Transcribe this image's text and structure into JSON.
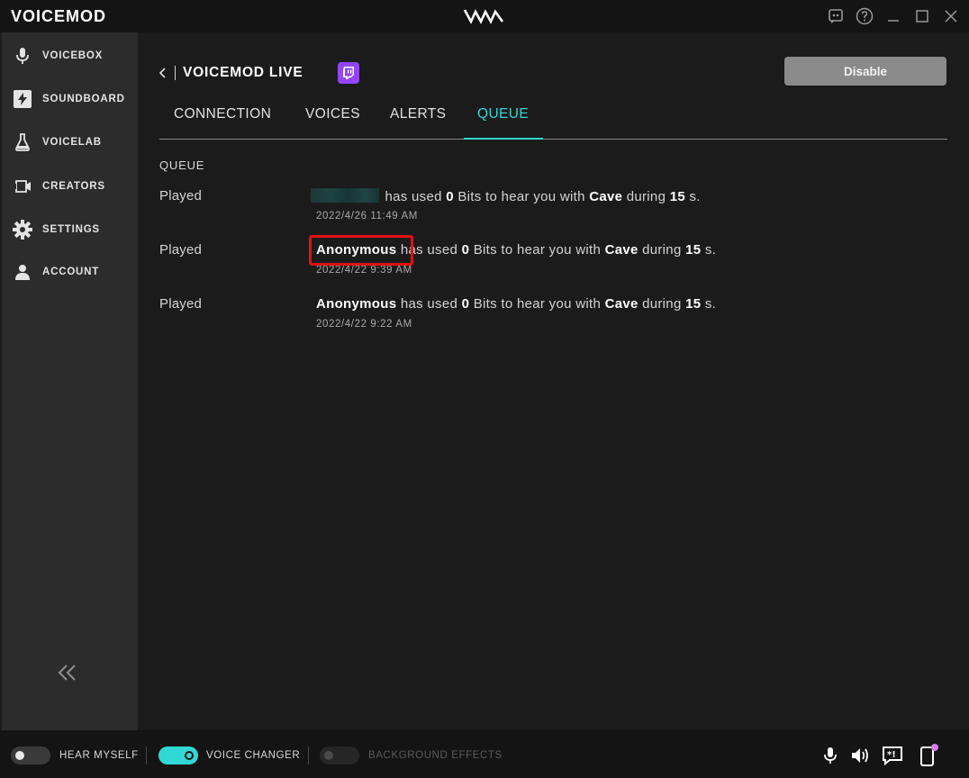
{
  "app": {
    "brand": "VOICEMOD",
    "logo_icon": "vm-logo-icon"
  },
  "window_controls": [
    {
      "name": "discord-icon"
    },
    {
      "name": "help-icon"
    },
    {
      "name": "minimize-icon"
    },
    {
      "name": "maximize-icon"
    },
    {
      "name": "close-icon"
    }
  ],
  "sidebar": {
    "items": [
      {
        "label": "VOICEBOX",
        "icon": "microphone-icon"
      },
      {
        "label": "SOUNDBOARD",
        "icon": "lightning-icon"
      },
      {
        "label": "VOICELAB",
        "icon": "flask-icon"
      },
      {
        "label": "CREATORS",
        "icon": "camera-icon"
      },
      {
        "label": "SETTINGS",
        "icon": "gear-icon"
      },
      {
        "label": "ACCOUNT",
        "icon": "user-icon"
      }
    ],
    "collapse_icon": "double-chevron-left-icon"
  },
  "header": {
    "title": "VOICEMOD LIVE",
    "disable_label": "Disable"
  },
  "tabs": [
    {
      "label": "CONNECTION",
      "active": false
    },
    {
      "label": "VOICES",
      "active": false
    },
    {
      "label": "ALERTS",
      "active": false
    },
    {
      "label": "QUEUE",
      "active": true
    }
  ],
  "queue": {
    "section_label": "QUEUE",
    "items": [
      {
        "status": "Played",
        "user": "",
        "user_blurred": true,
        "text_mid": "has used",
        "bits": "0",
        "text_bits": "Bits to hear you with",
        "voice": "Cave",
        "text_during": "during",
        "duration": "15",
        "unit": "s.",
        "time": "2022/4/26 11:49 AM"
      },
      {
        "status": "Played",
        "user": "Anonymous",
        "user_blurred": false,
        "text_mid": "has used",
        "bits": "0",
        "text_bits": "Bits to hear you with",
        "voice": "Cave",
        "text_during": "during",
        "duration": "15",
        "unit": "s.",
        "time": "2022/4/22 9:39 AM"
      },
      {
        "status": "Played",
        "user": "Anonymous",
        "user_blurred": false,
        "text_mid": "has used",
        "bits": "0",
        "text_bits": "Bits to hear you with",
        "voice": "Cave",
        "text_during": "during",
        "duration": "15",
        "unit": "s.",
        "time": "2022/4/22 9:22 AM"
      }
    ]
  },
  "bottom": {
    "hear_myself": {
      "label": "HEAR MYSELF",
      "on": false
    },
    "voice_changer": {
      "label": "VOICE CHANGER",
      "on": true
    },
    "background_effects": {
      "label": "BACKGROUND EFFECTS",
      "on": false,
      "disabled": true
    }
  },
  "colors": {
    "accent": "#31d8d6",
    "twitch": "#9146ff",
    "highlight": "#e21010"
  }
}
